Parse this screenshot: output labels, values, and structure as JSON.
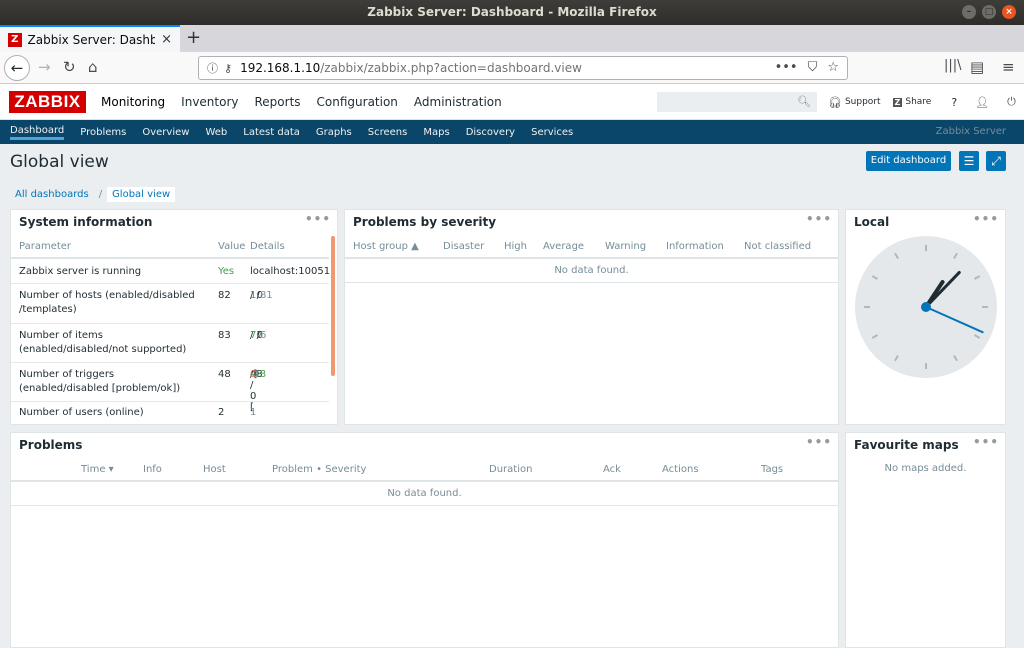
{
  "window": {
    "title": "Zabbix Server: Dashboard - Mozilla Firefox"
  },
  "browser": {
    "tab_title": "Zabbix Server: Dashboa",
    "favicon": "Z",
    "url_host": "192.168.1.10",
    "url_path": "/zabbix/zabbix.php?action=dashboard.view"
  },
  "header": {
    "logo": "ZABBIX",
    "menu": [
      "Monitoring",
      "Inventory",
      "Reports",
      "Configuration",
      "Administration"
    ],
    "support": "Support",
    "share": "Share",
    "help": "?"
  },
  "submenu": {
    "items": [
      "Dashboard",
      "Problems",
      "Overview",
      "Web",
      "Latest data",
      "Graphs",
      "Screens",
      "Maps",
      "Discovery",
      "Services"
    ],
    "server_name": "Zabbix Server"
  },
  "page": {
    "title": "Global view",
    "edit_button": "Edit dashboard",
    "breadcrumb_root": "All dashboards",
    "breadcrumb_sep": "/",
    "breadcrumb_current": "Global view"
  },
  "sysinfo": {
    "title": "System information",
    "col_param": "Parameter",
    "col_value": "Value",
    "col_details": "Details",
    "rows": [
      {
        "param": "Zabbix server is running",
        "value": "Yes",
        "details": "localhost:10051"
      },
      {
        "param": "Number of hosts (enabled/disabled /templates)",
        "value": "82",
        "d1": "1",
        "d2": "0",
        "d3": "81"
      },
      {
        "param": "Number of items (enabled/disabled/not supported)",
        "value": "83",
        "d1": "77",
        "d2": "0",
        "d3": "6"
      },
      {
        "param": "Number of triggers (enabled/disabled [problem/ok])",
        "value": "48",
        "d1": "48 / 0 [",
        "d2": "0",
        "d3": "48",
        "d4": "]"
      },
      {
        "param": "Number of users (online)",
        "value": "2",
        "details": "1"
      }
    ]
  },
  "severity": {
    "title": "Problems by severity",
    "cols": [
      "Host group ▲",
      "Disaster",
      "High",
      "Average",
      "Warning",
      "Information",
      "Not classified"
    ],
    "nodata": "No data found."
  },
  "clock": {
    "title": "Local",
    "hour": 1,
    "minute": 7,
    "second": 19
  },
  "problems": {
    "title": "Problems",
    "cols": [
      "Time ▾",
      "Info",
      "Host",
      "Problem • Severity",
      "Duration",
      "Ack",
      "Actions",
      "Tags"
    ],
    "nodata": "No data found."
  },
  "favmaps": {
    "title": "Favourite maps",
    "empty": "No maps added."
  },
  "widget_menu": "•••"
}
